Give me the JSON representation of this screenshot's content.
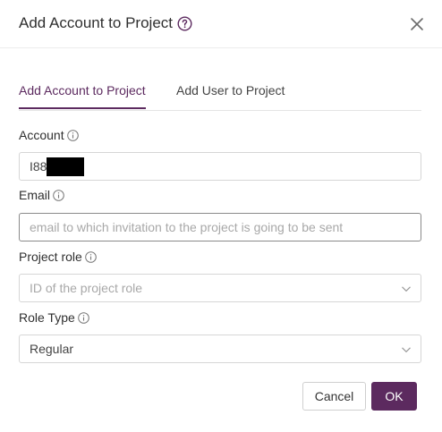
{
  "dialog": {
    "title": "Add Account to Project",
    "help_icon": "question-circle-icon",
    "close_icon": "close-icon"
  },
  "tabs": [
    {
      "label": "Add Account to Project",
      "active": true
    },
    {
      "label": "Add User to Project",
      "active": false
    }
  ],
  "form": {
    "account": {
      "label": "Account",
      "value": "I88"
    },
    "email": {
      "label": "Email",
      "placeholder": "email to which invitation to the project is going to be sent"
    },
    "project_role": {
      "label": "Project role",
      "placeholder": "ID of the project role"
    },
    "role_type": {
      "label": "Role Type",
      "value": "Regular"
    }
  },
  "buttons": {
    "cancel": "Cancel",
    "ok": "OK"
  },
  "colors": {
    "accent": "#5c2a5f",
    "border": "#d6d6d6",
    "placeholder": "#a8a8a8"
  }
}
